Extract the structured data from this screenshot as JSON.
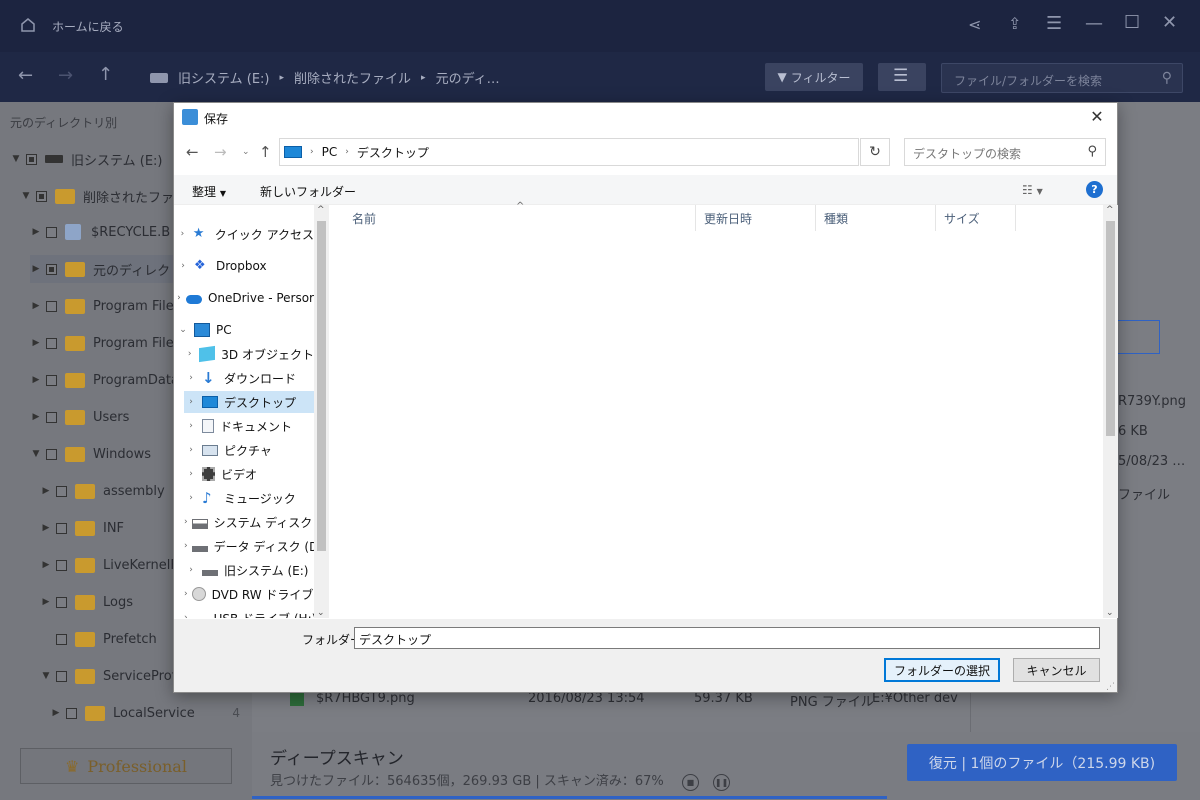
{
  "app": {
    "home_label": "ホームに戻る",
    "breadcrumb": [
      "旧システム (E:)",
      "削除されたファイル",
      "元のディ…"
    ],
    "filter_label": "フィルター",
    "search_placeholder": "ファイル/フォルダーを検索",
    "sidebar_heading": "元のディレクトリ別",
    "tree": [
      {
        "label": "旧システム (E:)"
      },
      {
        "label": "削除されたファイル"
      },
      {
        "label": "$RECYCLE.B"
      },
      {
        "label": "元のディレクトリ"
      },
      {
        "label": "Program File"
      },
      {
        "label": "Program File"
      },
      {
        "label": "ProgramData"
      },
      {
        "label": "Users"
      },
      {
        "label": "Windows"
      },
      {
        "label": "assembly"
      },
      {
        "label": "INF"
      },
      {
        "label": "LiveKernelF"
      },
      {
        "label": "Logs"
      },
      {
        "label": "Prefetch"
      },
      {
        "label": "ServiceProf"
      },
      {
        "label": "LocalService",
        "count": "4"
      }
    ],
    "pro_label": "Professional",
    "scan_title": "ディープスキャン",
    "scan_status": "見つけたファイル：564635個，269.93 GB | スキャン済み：67%",
    "restore_label": "復元 | 1個のファイル（215.99 KB)",
    "progress_percent": 67,
    "right_panel": {
      "filename": "R739Y.png",
      "size": "6 KB",
      "date": "5/08/23 …",
      "type": "ファイル"
    },
    "partial_row": {
      "name": "$R7HBGT9.png",
      "date": "2016/08/23 13:54",
      "size": "59.37 KB",
      "type": "PNG ファイル",
      "path": "E:¥Other dev"
    }
  },
  "dialog": {
    "title": "保存",
    "address": [
      "PC",
      "デスクトップ"
    ],
    "search_placeholder": "デスクトップの検索",
    "organize_label": "整理",
    "new_folder_label": "新しいフォルダー",
    "nav": [
      {
        "label": "クイック アクセス",
        "icon": "star-icon"
      },
      {
        "label": "Dropbox",
        "icon": "dropbox-icon"
      },
      {
        "label": "OneDrive - Persor",
        "icon": "cloud-icon"
      },
      {
        "label": "PC",
        "icon": "pc-icon"
      },
      {
        "label": "3D オブジェクト",
        "icon": "cube-icon"
      },
      {
        "label": "ダウンロード",
        "icon": "download-icon"
      },
      {
        "label": "デスクトップ",
        "icon": "desktop-icon"
      },
      {
        "label": "ドキュメント",
        "icon": "document-icon"
      },
      {
        "label": "ピクチャ",
        "icon": "picture-icon"
      },
      {
        "label": "ビデオ",
        "icon": "video-icon"
      },
      {
        "label": "ミュージック",
        "icon": "music-icon"
      },
      {
        "label": "システム ディスク (C",
        "icon": "system-disk-icon"
      },
      {
        "label": "データ ディスク (D:)",
        "icon": "drive-icon"
      },
      {
        "label": "旧システム (E:)",
        "icon": "drive-icon"
      },
      {
        "label": "DVD RW ドライブ (",
        "icon": "dvd-icon"
      },
      {
        "label": "USB ドライブ (H:)",
        "icon": "usb-icon"
      }
    ],
    "columns": [
      "名前",
      "更新日時",
      "種類",
      "サイズ"
    ],
    "folder_label": "フォルダー:",
    "folder_value": "デスクトップ",
    "select_button": "フォルダーの選択",
    "cancel_button": "キャンセル"
  }
}
